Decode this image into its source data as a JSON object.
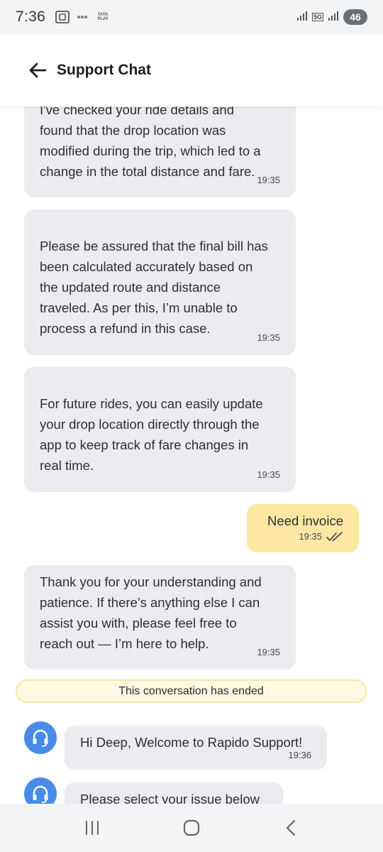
{
  "status_bar": {
    "time": "7:36",
    "notification_icons": [
      "screenshot-icon",
      "jio-icon",
      "tata-play-icon"
    ],
    "tata_play_label": "TATA PLAY",
    "network_type": "5G",
    "battery": "46"
  },
  "header": {
    "title": "Support Chat"
  },
  "messages": [
    {
      "sender": "agent",
      "lines": [
        "I've checked your ride details and",
        "found that the drop location was",
        "modified during the trip, which led to a",
        "change in the total distance and fare."
      ],
      "time": "19:35"
    },
    {
      "sender": "agent",
      "lines": [
        "Please be assured that the final bill has",
        "been calculated accurately based on",
        "the updated route and distance",
        "traveled. As per this, I’m unable to",
        "process a refund in this case."
      ],
      "time": "19:35"
    },
    {
      "sender": "agent",
      "lines": [
        "For future rides, you can easily update",
        "your drop location directly through the",
        "app to keep track of fare changes in",
        "real time."
      ],
      "time": "19:35"
    },
    {
      "sender": "user",
      "lines": [
        "Need invoice"
      ],
      "time": "19:35",
      "status": "read"
    },
    {
      "sender": "agent",
      "lines": [
        "Thank you for your understanding and",
        "patience. If there’s anything else I can",
        "assist you with, please feel free to",
        "reach out — I’m here to help."
      ],
      "time": "19:35"
    }
  ],
  "conversation_ended": "This conversation has ended",
  "bot_messages": [
    {
      "lines": [
        "Hi Deep, Welcome to Rapido Support!"
      ],
      "time": "19:36"
    },
    {
      "lines": [
        "Please select your issue below"
      ],
      "time": ""
    }
  ],
  "colors": {
    "agent_bubble": "#ececf0",
    "user_bubble": "#fde8a3",
    "avatar": "#4a8be8",
    "read_ticks": "#3a3f44"
  }
}
